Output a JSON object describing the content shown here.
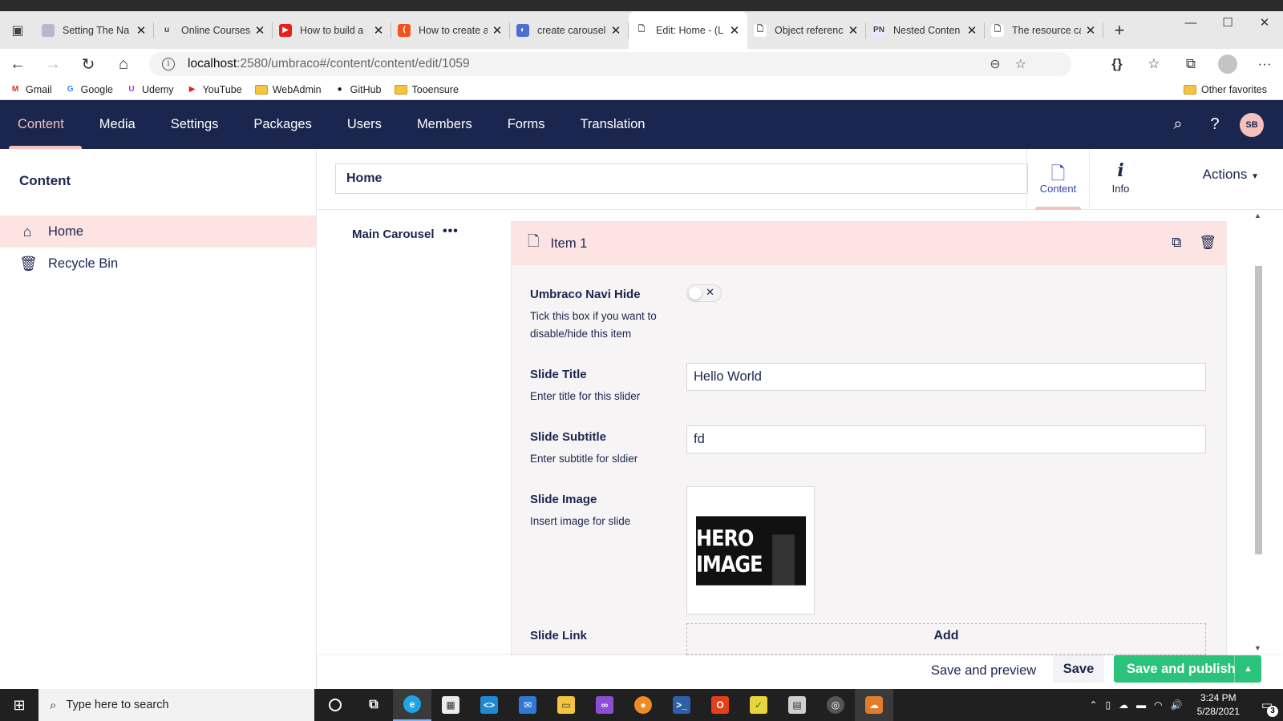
{
  "browser": {
    "tabs": [
      {
        "title": "Setting The Na",
        "icon_color": "#b8b8c8",
        "icon_glyph": ""
      },
      {
        "title": "Online Courses",
        "icon_color": "#e9e9e9",
        "icon_glyph": "u"
      },
      {
        "title": "How to build a",
        "icon_color": "#e62117",
        "icon_glyph": "▶"
      },
      {
        "title": "How to create a",
        "icon_color": "#f4511e",
        "icon_glyph": "⟨"
      },
      {
        "title": "create carousel",
        "icon_color": "#4b6ed1",
        "icon_glyph": "◐"
      },
      {
        "title": "Edit: Home - (L",
        "icon_color": "#ffffff",
        "icon_glyph": "🗋",
        "active": true
      },
      {
        "title": "Object referenc",
        "icon_color": "#ffffff",
        "icon_glyph": "🗋"
      },
      {
        "title": "Nested Conten",
        "icon_color": "#ece8f6",
        "icon_glyph": "PN"
      },
      {
        "title": "The resource ca",
        "icon_color": "#ffffff",
        "icon_glyph": "🗋"
      }
    ],
    "url_host": "localhost",
    "url_path": ":2580/umbraco#/content/content/edit/1059",
    "bookmarks": [
      {
        "label": "Gmail",
        "icon": "M",
        "color": "#d93025",
        "folder": false
      },
      {
        "label": "Google",
        "icon": "G",
        "color": "#4285f4",
        "folder": false
      },
      {
        "label": "Udemy",
        "icon": "U",
        "color": "#a435f0",
        "folder": false
      },
      {
        "label": "YouTube",
        "icon": "▶",
        "color": "#e62117",
        "folder": false
      },
      {
        "label": "WebAdmin",
        "icon": "",
        "color": "",
        "folder": true
      },
      {
        "label": "GitHub",
        "icon": "●",
        "color": "#111111",
        "folder": false
      },
      {
        "label": "Tooensure",
        "icon": "",
        "color": "",
        "folder": true
      }
    ],
    "other_favorites": "Other favorites"
  },
  "umbraco": {
    "sections": [
      "Content",
      "Media",
      "Settings",
      "Packages",
      "Users",
      "Members",
      "Forms",
      "Translation"
    ],
    "active_section": "Content",
    "user_initials": "SB",
    "tree": {
      "title": "Content",
      "items": [
        {
          "label": "Home",
          "icon": "home-icon",
          "selected": true
        },
        {
          "label": "Recycle Bin",
          "icon": "trash-icon",
          "selected": false
        }
      ]
    },
    "editor": {
      "node_name": "Home",
      "apps": [
        {
          "label": "Content",
          "icon": "document-icon",
          "active": true
        },
        {
          "label": "Info",
          "icon": "info-icon",
          "active": false
        }
      ],
      "actions_label": "Actions",
      "property_label": "Main Carousel",
      "property_menu": "•••",
      "nested_item": {
        "title": "Item 1",
        "fields": {
          "navi_hide": {
            "label": "Umbraco Navi Hide",
            "description": "Tick this box if you want to disable/hide this item",
            "value": false
          },
          "slide_title": {
            "label": "Slide Title",
            "description": "Enter title for this slider",
            "value": "Hello World"
          },
          "slide_subtitle": {
            "label": "Slide Subtitle",
            "description": "Enter subtitle for sldier",
            "value": "fd"
          },
          "slide_image": {
            "label": "Slide Image",
            "description": "Insert image for slide",
            "image_text": "HERO IMAGE"
          },
          "slide_link": {
            "label": "Slide Link",
            "add_label": "Add"
          }
        }
      }
    },
    "footer": {
      "save_preview": "Save and preview",
      "save": "Save",
      "save_publish": "Save and publish"
    }
  },
  "taskbar": {
    "search_placeholder": "Type here to search",
    "time": "3:24 PM",
    "date": "5/28/2021",
    "notifications": "3"
  }
}
